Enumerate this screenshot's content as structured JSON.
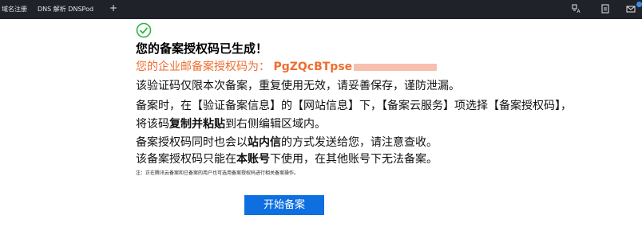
{
  "topbar": {
    "items": [
      "域名注册",
      "DNS 解析 DNSPod"
    ],
    "add_label": "+",
    "icons": [
      "translate-icon",
      "document-icon",
      "mail-icon"
    ],
    "background": "#1f2229"
  },
  "content": {
    "title": "您的备案授权码已生成！",
    "code_label": "您的企业邮备案授权码为：",
    "code_value": "PgZQcBTpse",
    "lines": [
      "该验证码仅限本次备案，重复使用无效，请妥善保存，谨防泄漏。",
      "备案时，在【验证备案信息】的【网站信息】下，【备案云服务】项选择【备案授权码】，",
      "将该码",
      "复制并粘贴",
      "到右侧编辑区域内。",
      "备案授权码同时也会以",
      "站内信",
      "的方式发送给您，请注意查收。",
      "该备案授权码只能在",
      "本账号",
      "下使用，在其他账号下无法备案。"
    ],
    "note": "注：正在腾讯云备案和已备案的用户也可选用备案授权码进行相关备案操作。",
    "button_label": "开始备案"
  },
  "colors": {
    "accent_orange": "#ee6e31",
    "button_blue": "#0d6fe0",
    "success_green": "#2fb344"
  }
}
